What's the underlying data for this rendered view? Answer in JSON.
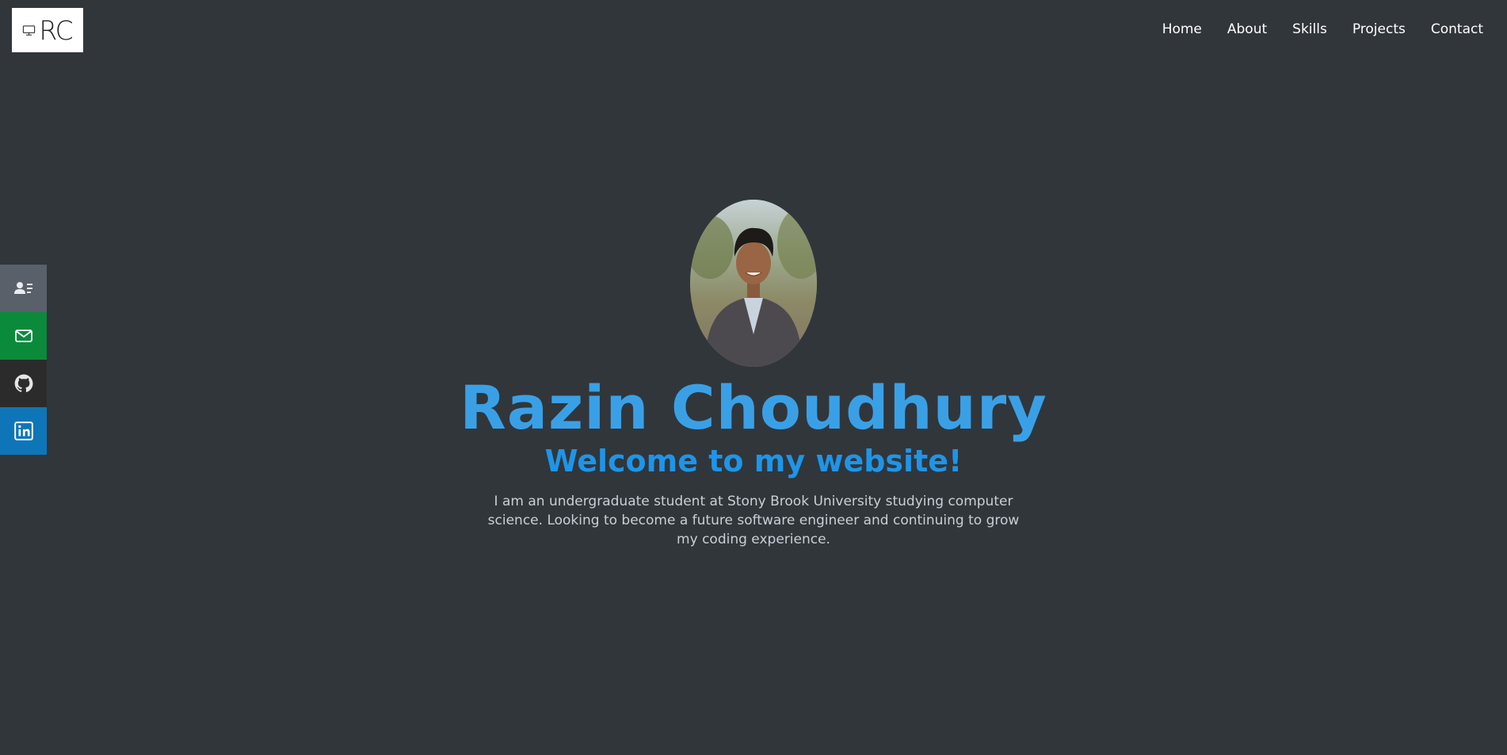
{
  "header": {
    "logo_text": "RC",
    "logo_icon": "desktop-computer-icon",
    "nav": [
      "Home",
      "About",
      "Skills",
      "Projects",
      "Contact"
    ]
  },
  "side_bar": {
    "items": [
      {
        "icon": "resume-icon",
        "color": "#59606a"
      },
      {
        "icon": "email-icon",
        "color": "#0b8a3c"
      },
      {
        "icon": "github-icon",
        "color": "#2b2b2b"
      },
      {
        "icon": "linkedin-icon",
        "color": "#0e76b8"
      }
    ]
  },
  "hero": {
    "name": "Razin Choudhury",
    "welcome": "Welcome to my website!",
    "description": "I am an undergraduate student at Stony Brook University studying computer science. Looking to become a future software engineer and continuing to grow my coding experience."
  },
  "colors": {
    "background": "#31363b",
    "name": "#3aa0e6",
    "welcome": "#1e95e8",
    "text": "#c9cfd6"
  }
}
